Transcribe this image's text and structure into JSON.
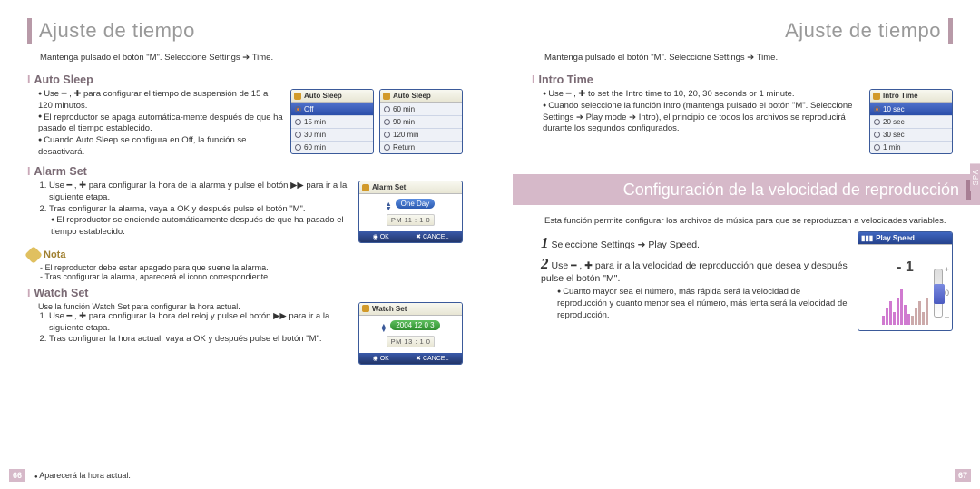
{
  "left": {
    "title": "Ajuste de tiempo",
    "top_instruction": "Mantenga pulsado el botón \"M\". Seleccione Settings ➔ Time.",
    "auto_sleep": {
      "heading": "Auto Sleep",
      "b1": "Use ━ , ✚ para configurar el tiempo de suspensión de 15 a 120 minutos.",
      "b2": "El reproductor se apaga automática-mente después de que ha pasado el tiempo establecido.",
      "b3": "Cuando Auto Sleep se configura en Off, la función se desactivará.",
      "dev_title": "Auto Sleep",
      "dev1": {
        "r1": "Off",
        "r2": "15 min",
        "r3": "30 min",
        "r4": "60 min"
      },
      "dev2": {
        "r1": "60 min",
        "r2": "90 min",
        "r3": "120 min",
        "r4": "Return"
      }
    },
    "alarm_set": {
      "heading": "Alarm Set",
      "n1": "Use ━ , ✚ para configurar la hora de la alarma y pulse el botón ▶▶ para ir a la siguiente etapa.",
      "n2": "Tras configurar la alarma, vaya a OK y después pulse el botón \"M\".",
      "sub": "El reproductor se enciende automáticamente después de que ha pasado el tiempo establecido.",
      "dev_title": "Alarm Set",
      "pill": "One Day",
      "time": "PM  11 : 1  0"
    },
    "nota": {
      "label": "Nota",
      "l1": "- El reproductor debe estar apagado para que suene la alarma.",
      "l2": "- Tras configurar la alarma, aparecerá el icono correspondiente."
    },
    "watch_set": {
      "heading": "Watch Set",
      "intro": "Use la función Watch Set para configurar la hora actual.",
      "n1": "Use ━ , ✚ para configurar la hora del reloj y pulse el botón ▶▶ para ir a la siguiente etapa.",
      "n2": "Tras configurar la hora actual, vaya a OK y después pulse el botón \"M\".",
      "dev_title": "Watch Set",
      "date": "2004  12  0 3",
      "time": "PM  13 : 1  0"
    },
    "footer": "Aparecerá la hora actual.",
    "page_no": "66"
  },
  "right": {
    "title": "Ajuste de tiempo",
    "top_instruction": "Mantenga pulsado el botón \"M\". Seleccione Settings ➔ Time.",
    "intro_time": {
      "heading": "Intro Time",
      "b1": "Use ━ , ✚ to set the Intro time to 10, 20, 30 seconds or 1 minute.",
      "b2": "Cuando seleccione la función Intro (mantenga pulsado el botón \"M\". Seleccione Settings ➔ Play mode ➔ Intro), el principio de todos los archivos se reproducirá durante los segundos configurados.",
      "dev_title": "Intro Time",
      "r1": "10 sec",
      "r2": "20 sec",
      "r3": "30 sec",
      "r4": "1 min"
    },
    "speed_section": {
      "banner": "Configuración de la velocidad de reproducción",
      "intro": "Esta función permite configurar los archivos de música para que se reproduzcan a velocidades variables.",
      "s1": "Seleccione Settings ➔ Play Speed.",
      "s2": "Use ━ , ✚ para ir a la velocidad de reproducción que desea y después pulse el botón \"M\".",
      "sub": "Cuanto mayor sea el número, más rápida será la velocidad de reproducción y cuanto menor sea el número, más lenta será la velocidad de reproducción.",
      "dev_title": "Play Speed",
      "value": "- 1",
      "plus": "+",
      "zero": "0",
      "minus": "–"
    },
    "spa": "SPA",
    "page_no": "67",
    "ok": "OK",
    "cancel": "CANCEL"
  }
}
